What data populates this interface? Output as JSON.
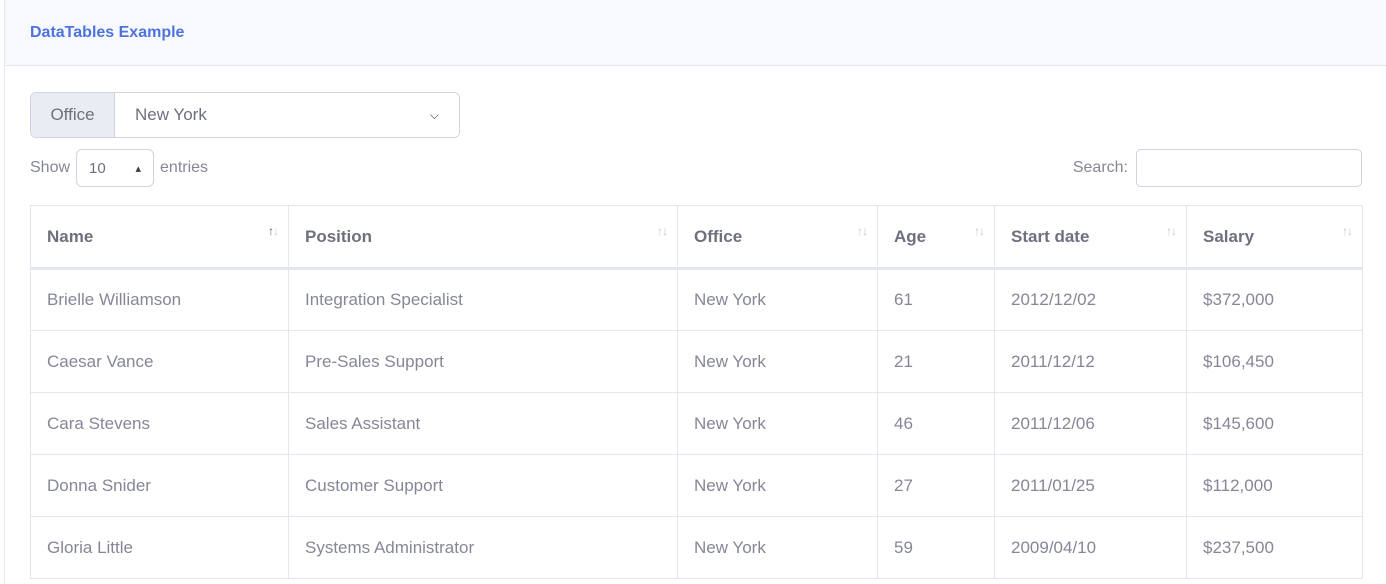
{
  "card": {
    "title": "DataTables Example"
  },
  "filter": {
    "label": "Office",
    "selected": "New York"
  },
  "length": {
    "show": "Show",
    "value": "10",
    "entries": "entries"
  },
  "search": {
    "label": "Search:",
    "value": "",
    "placeholder": ""
  },
  "table": {
    "columns": [
      "Name",
      "Position",
      "Office",
      "Age",
      "Start date",
      "Salary"
    ],
    "sorted_column": "Name",
    "rows": [
      [
        "Brielle Williamson",
        "Integration Specialist",
        "New York",
        "61",
        "2012/12/02",
        "$372,000"
      ],
      [
        "Caesar Vance",
        "Pre-Sales Support",
        "New York",
        "21",
        "2011/12/12",
        "$106,450"
      ],
      [
        "Cara Stevens",
        "Sales Assistant",
        "New York",
        "46",
        "2011/12/06",
        "$145,600"
      ],
      [
        "Donna Snider",
        "Customer Support",
        "New York",
        "27",
        "2011/01/25",
        "$112,000"
      ],
      [
        "Gloria Little",
        "Systems Administrator",
        "New York",
        "59",
        "2009/04/10",
        "$237,500"
      ]
    ]
  },
  "colors": {
    "accent": "#4e73df",
    "text": "#858796",
    "border": "#e3e6f0"
  }
}
